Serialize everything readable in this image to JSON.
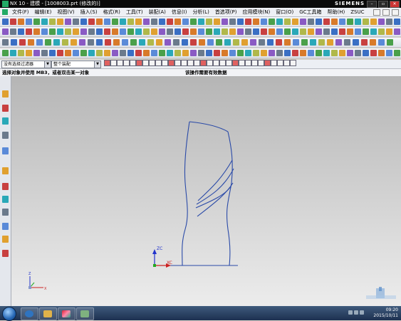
{
  "window": {
    "title": "NX 10 - 建模 - [1008003.prt (修改的)]",
    "brand": "SIEMENS",
    "controls": [
      "–",
      "▫",
      "✕"
    ]
  },
  "menu": {
    "items": [
      "文件(F)",
      "编辑(E)",
      "视图(V)",
      "插入(S)",
      "格式(R)",
      "工具(T)",
      "装配(A)",
      "信息(I)",
      "分析(L)",
      "首选项(P)",
      "应用模块(N)",
      "窗口(O)",
      "GC工具箱",
      "帮助(H)",
      "ZSUC"
    ]
  },
  "selection_bar": {
    "filter_value": "没有选择过滤器",
    "scope_value": "整个装配"
  },
  "status": {
    "prompt": "选择对象并使用 MB3，或者双击某一对象",
    "message": "该操作需要有效数据"
  },
  "viewport": {
    "wcs_labels": {
      "zc": "ZC",
      "xc": "XC"
    },
    "triad_labels": {
      "z": "Z",
      "x": "X"
    },
    "curve_color": "#2a4aa8",
    "background_top": "#b5b5b5",
    "background_bottom": "#ececec"
  },
  "taskbar": {
    "time": "09:20",
    "date": "2015/10/11",
    "apps": [
      "windows-icon",
      "sogou-icon",
      "folder-icon",
      "nx-icon",
      "paint-icon"
    ]
  }
}
